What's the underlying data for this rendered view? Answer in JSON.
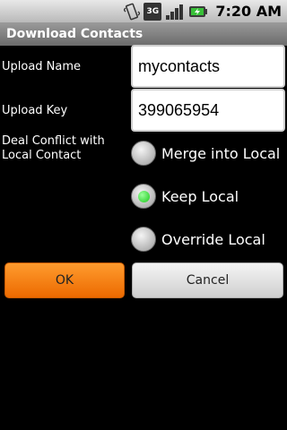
{
  "status_bar": {
    "network_label": "3G",
    "time": "7:20",
    "time_suffix": "AM",
    "icons": [
      "vibrate-icon",
      "network-3g-icon",
      "signal-icon",
      "battery-charging-icon"
    ]
  },
  "title_bar": {
    "title": "Download Contacts"
  },
  "form": {
    "upload_name_label": "Upload Name",
    "upload_name_value": "mycontacts",
    "upload_key_label": "Upload Key",
    "upload_key_value": "399065954",
    "conflict_label_line1": "Deal Conflict with",
    "conflict_label_line2": "Local Contact",
    "options": [
      {
        "label": "Merge into Local",
        "selected": false
      },
      {
        "label": "Keep Local",
        "selected": true
      },
      {
        "label": "Override Local",
        "selected": false
      }
    ]
  },
  "buttons": {
    "ok": "OK",
    "cancel": "Cancel"
  },
  "colors": {
    "accent": "#f57c0a",
    "radio_selected": "#19c819"
  }
}
